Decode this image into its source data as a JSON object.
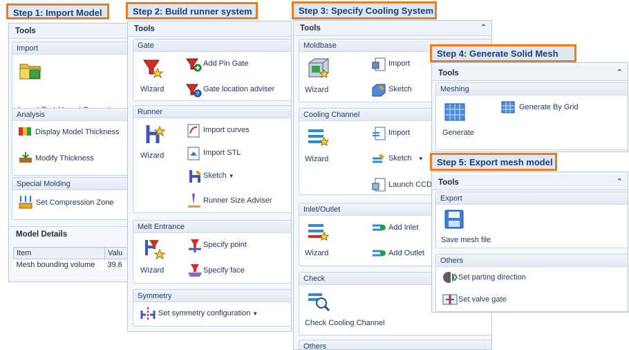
{
  "steps": {
    "s1": "Step 1: Import Model",
    "s2": "Step 2: Build runner system",
    "s3": "Step 3: Specify Cooling System",
    "s4": "Step 4: Generate Solid Mesh",
    "s5": "Step 5: Export mesh model"
  },
  "tools_title": "Tools",
  "panel1": {
    "import_group": "Import",
    "import_item": "Import Part / Insert Geometry",
    "analysis_group": "Analysis",
    "display_thickness": "Display Model Thickness",
    "modify_thickness": "Modify Thickness",
    "special_group": "Special Molding",
    "compression_zone": "Set Compression Zone",
    "model_details": "Model Details",
    "table_headers": [
      "Item",
      "Valu"
    ],
    "table_rows": [
      [
        "Mesh bounding volume",
        "39.6"
      ]
    ]
  },
  "panel2": {
    "gate_group": "Gate",
    "wizard": "Wizard",
    "add_pin_gate": "Add Pin Gate",
    "gate_location": "Gate location adviser",
    "runner_group": "Runner",
    "import_curves": "Import curves",
    "import_stl": "Import STL",
    "sketch": "Sketch",
    "runner_size": "Runner Size Adviser",
    "melt_group": "Melt Entrance",
    "specify_point": "Specify point",
    "specify_face": "Specify face",
    "symmetry_group": "Symmetry",
    "symmetry_config": "Set symmetry configuration"
  },
  "panel3": {
    "moldbase_group": "Moldbase",
    "wizard": "Wizard",
    "import": "Import",
    "sketch": "Sketch",
    "cooling_group": "Cooling Channel",
    "launch_ccd": "Launch CCD",
    "inlet_group": "Inlet/Outlet",
    "add_inlet": "Add Inlet",
    "add_outlet": "Add Outlet",
    "check_group": "Check",
    "check_cooling": "Check Cooling Channel",
    "others_group": "Others"
  },
  "panel4": {
    "meshing_group": "Meshing",
    "generate_by_grid": "Generate By Grid",
    "generate": "Generate"
  },
  "panel5": {
    "export_group": "Export",
    "save_mesh": "Save mesh file",
    "others_group": "Others",
    "parting_direction": "Set parting direction",
    "valve_gate": "Set valve gate"
  },
  "icons": {
    "collapse": "double-chevron-up-icon",
    "dropdown": "triangle-down-icon"
  },
  "colors": {
    "step_border": "#f07a1e",
    "step_bg": "#dde8f5",
    "step_text": "#1b3e78"
  }
}
